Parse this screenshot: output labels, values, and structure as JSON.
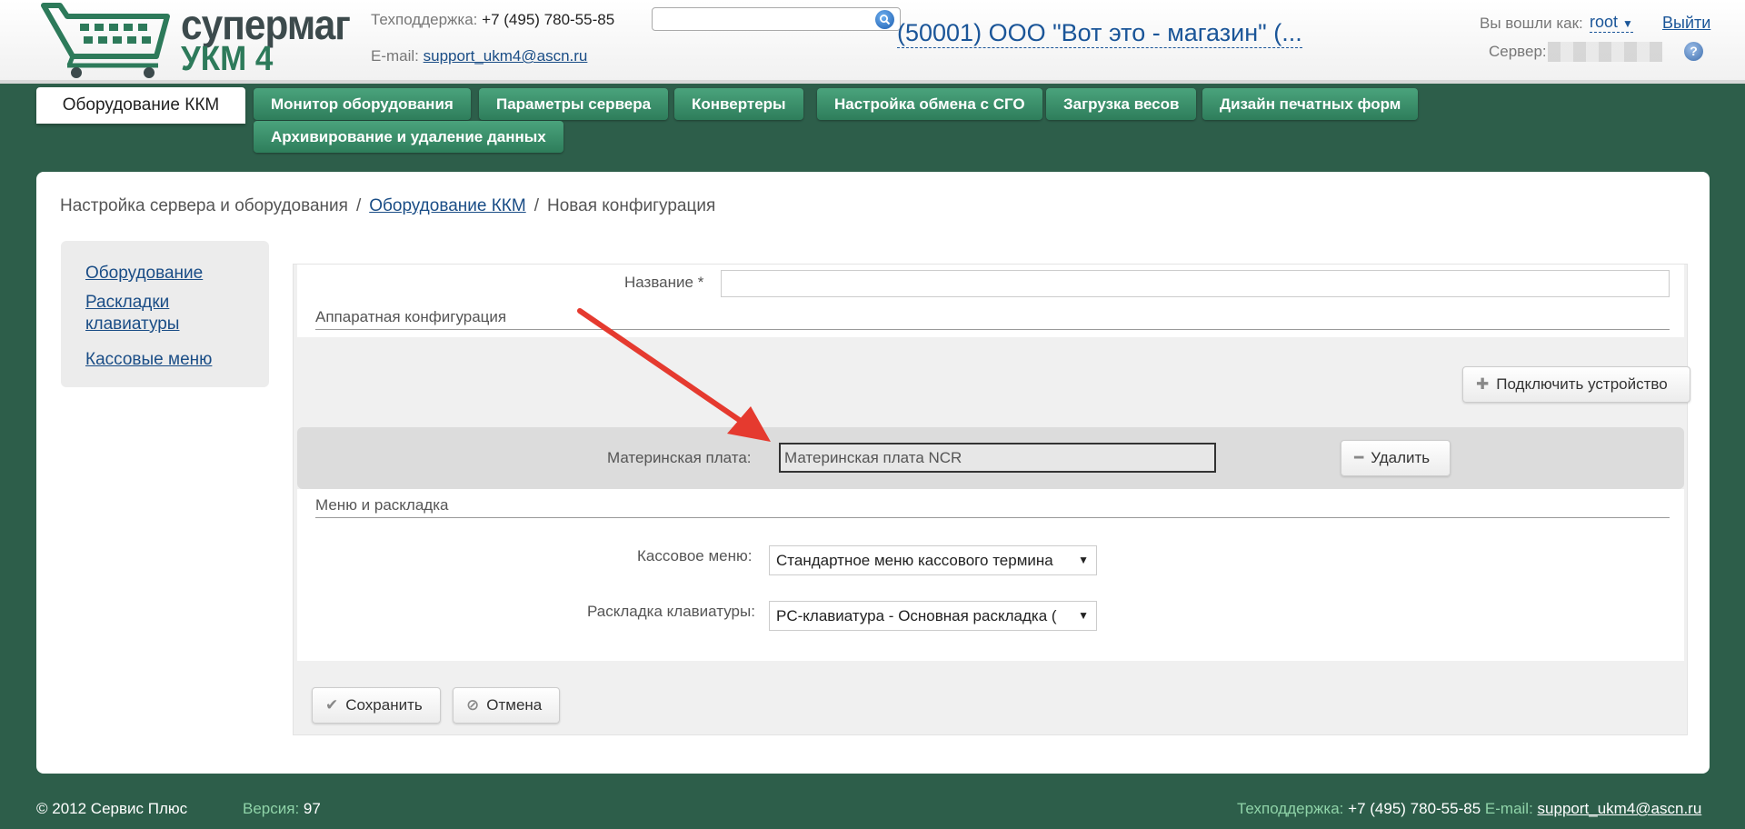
{
  "header": {
    "logo": {
      "line1": "супермаг",
      "line2": "УКМ 4"
    },
    "support_label": "Техподдержка:",
    "support_phone": "+7 (495) 780-55-85",
    "email_label": "E-mail:",
    "email": "support_ukm4@ascn.ru",
    "search": {
      "value": "",
      "placeholder": ""
    },
    "company": "(50001) ООО \"Вот это - магазин\" (...",
    "login_label": "Вы вошли как:",
    "login_user": "root",
    "logout": "Выйти",
    "server_label": "Сервер:",
    "help": "?"
  },
  "nav": {
    "active_tab": "Оборудование ККМ",
    "tabs": [
      "Монитор оборудования",
      "Параметры сервера",
      "Конвертеры",
      "Настройка обмена с СГО",
      "Загрузка весов",
      "Дизайн печатных форм",
      "Архивирование и удаление данных"
    ]
  },
  "breadcrumb": {
    "root": "Настройка сервера и оборудования",
    "link": "Оборудование ККМ",
    "current": "Новая конфигурация",
    "separator": "/"
  },
  "sidebar": {
    "items": [
      "Оборудование",
      "Раскладки клавиатуры",
      "Кассовые меню"
    ]
  },
  "form": {
    "name_label": "Название *",
    "name_value": "",
    "hw_section": "Аппаратная конфигурация",
    "connect_button": "Подключить устройство",
    "device_label": "Материнская плата:",
    "device_value": "Материнская плата NCR",
    "delete_button": "Удалить",
    "menu_section": "Меню и раскладка",
    "cash_menu_label": "Кассовое меню:",
    "cash_menu_value": "Стандартное меню кассового термина",
    "keyboard_label": "Раскладка клавиатуры:",
    "keyboard_value": "PC-клавиатура - Основная раскладка (",
    "save_button": "Сохранить",
    "cancel_button": "Отмена"
  },
  "footer": {
    "copyright": "© 2012 Сервис Плюс",
    "version_label": "Версия:",
    "version": "97",
    "support_label": "Техподдержка:",
    "support_phone": "+7 (495) 780-55-85",
    "email_label": "E-mail:",
    "email": "support_ukm4@ascn.ru"
  },
  "icons": {
    "search": "search-icon",
    "dropdown": "triangle-down-icon",
    "plus": "plus-icon",
    "minus": "minus-icon",
    "check": "check-icon",
    "cancel": "ban-icon",
    "help": "question-icon",
    "cart": "cart-icon",
    "arrow": "red-arrow-icon"
  },
  "colors": {
    "background": "#2d5e4a",
    "nav_tab": "#3a8f69",
    "link": "#1a4d86",
    "arrow": "#e53a2f"
  }
}
